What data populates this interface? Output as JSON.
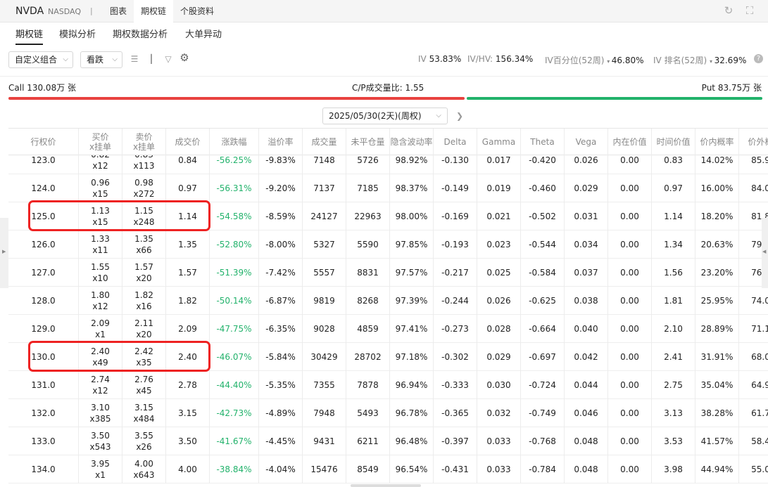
{
  "header": {
    "ticker": "NVDA",
    "exchange": "NASDAQ",
    "separator": "|",
    "tabs": [
      "图表",
      "期权链",
      "个股资料"
    ],
    "active_tab": "期权链"
  },
  "subnav": {
    "tabs": [
      "期权链",
      "模拟分析",
      "期权数据分析",
      "大单异动"
    ]
  },
  "filters": {
    "combo": "自定义组合",
    "direction": "看跌"
  },
  "stats": {
    "iv_label": "IV",
    "iv_value": "53.83%",
    "ivhv_label": "IV/HV:",
    "ivhv_value": "156.34%",
    "iv_pct_label": "IV百分位(52周)",
    "iv_pct_value": "46.80%",
    "iv_rank_label": "IV 排名(52周)",
    "iv_rank_value": "32.69%"
  },
  "cp": {
    "call_text": "Call 130.08万 张",
    "ratio_text": "C/P成交量比:  1.55",
    "put_text": "Put 83.75万 张",
    "call_share": 0.608
  },
  "expiry": {
    "label": "2025/05/30(2天)(周权)"
  },
  "columns": [
    [
      "行权价"
    ],
    [
      "买价",
      "x挂单"
    ],
    [
      "卖价",
      "x挂单"
    ],
    [
      "成交价"
    ],
    [
      "涨跌幅"
    ],
    [
      "溢价率"
    ],
    [
      "成交量"
    ],
    [
      "未平仓量"
    ],
    [
      "隐含波动率"
    ],
    [
      "Delta"
    ],
    [
      "Gamma"
    ],
    [
      "Theta"
    ],
    [
      "Vega"
    ],
    [
      "内在价值"
    ],
    [
      "时间价值"
    ],
    [
      "价内概率"
    ],
    [
      "价外概"
    ]
  ],
  "rows": [
    {
      "strike": "123.0",
      "bid": "0.82",
      "bid_size": "x12",
      "ask": "0.83",
      "ask_size": "x113",
      "last": "0.84",
      "chg": "-56.25%",
      "prem": "-9.83%",
      "vol": "7148",
      "oi": "5726",
      "iv": "98.92%",
      "delta": "-0.130",
      "gamma": "0.017",
      "theta": "-0.420",
      "vega": "0.026",
      "intrinsic": "0.00",
      "time": "0.83",
      "itm": "14.02%",
      "otm": "85.9"
    },
    {
      "strike": "124.0",
      "bid": "0.96",
      "bid_size": "x15",
      "ask": "0.98",
      "ask_size": "x272",
      "last": "0.97",
      "chg": "-56.31%",
      "prem": "-9.20%",
      "vol": "7137",
      "oi": "7185",
      "iv": "98.37%",
      "delta": "-0.149",
      "gamma": "0.019",
      "theta": "-0.460",
      "vega": "0.029",
      "intrinsic": "0.00",
      "time": "0.97",
      "itm": "16.00%",
      "otm": "84.0"
    },
    {
      "strike": "125.0",
      "bid": "1.13",
      "bid_size": "x15",
      "ask": "1.15",
      "ask_size": "x248",
      "last": "1.14",
      "chg": "-54.58%",
      "prem": "-8.59%",
      "vol": "24127",
      "oi": "22963",
      "iv": "98.00%",
      "delta": "-0.169",
      "gamma": "0.021",
      "theta": "-0.502",
      "vega": "0.031",
      "intrinsic": "0.00",
      "time": "1.14",
      "itm": "18.20%",
      "otm": "81.8"
    },
    {
      "strike": "126.0",
      "bid": "1.33",
      "bid_size": "x11",
      "ask": "1.35",
      "ask_size": "x66",
      "last": "1.35",
      "chg": "-52.80%",
      "prem": "-8.00%",
      "vol": "5327",
      "oi": "5590",
      "iv": "97.85%",
      "delta": "-0.193",
      "gamma": "0.023",
      "theta": "-0.544",
      "vega": "0.034",
      "intrinsic": "0.00",
      "time": "1.34",
      "itm": "20.63%",
      "otm": "79.3"
    },
    {
      "strike": "127.0",
      "bid": "1.55",
      "bid_size": "x10",
      "ask": "1.57",
      "ask_size": "x20",
      "last": "1.57",
      "chg": "-51.39%",
      "prem": "-7.42%",
      "vol": "5557",
      "oi": "8831",
      "iv": "97.57%",
      "delta": "-0.217",
      "gamma": "0.025",
      "theta": "-0.584",
      "vega": "0.037",
      "intrinsic": "0.00",
      "time": "1.56",
      "itm": "23.20%",
      "otm": "76.8"
    },
    {
      "strike": "128.0",
      "bid": "1.80",
      "bid_size": "x12",
      "ask": "1.82",
      "ask_size": "x16",
      "last": "1.82",
      "chg": "-50.14%",
      "prem": "-6.87%",
      "vol": "9819",
      "oi": "8268",
      "iv": "97.39%",
      "delta": "-0.244",
      "gamma": "0.026",
      "theta": "-0.625",
      "vega": "0.038",
      "intrinsic": "0.00",
      "time": "1.81",
      "itm": "25.95%",
      "otm": "74.0"
    },
    {
      "strike": "129.0",
      "bid": "2.09",
      "bid_size": "x1",
      "ask": "2.11",
      "ask_size": "x20",
      "last": "2.09",
      "chg": "-47.75%",
      "prem": "-6.35%",
      "vol": "9028",
      "oi": "4859",
      "iv": "97.41%",
      "delta": "-0.273",
      "gamma": "0.028",
      "theta": "-0.664",
      "vega": "0.040",
      "intrinsic": "0.00",
      "time": "2.10",
      "itm": "28.89%",
      "otm": "71.1"
    },
    {
      "strike": "130.0",
      "bid": "2.40",
      "bid_size": "x49",
      "ask": "2.42",
      "ask_size": "x35",
      "last": "2.40",
      "chg": "-46.07%",
      "prem": "-5.84%",
      "vol": "30429",
      "oi": "28702",
      "iv": "97.18%",
      "delta": "-0.302",
      "gamma": "0.029",
      "theta": "-0.697",
      "vega": "0.042",
      "intrinsic": "0.00",
      "time": "2.41",
      "itm": "31.91%",
      "otm": "68.0"
    },
    {
      "strike": "131.0",
      "bid": "2.74",
      "bid_size": "x12",
      "ask": "2.76",
      "ask_size": "x45",
      "last": "2.78",
      "chg": "-44.40%",
      "prem": "-5.35%",
      "vol": "7355",
      "oi": "7878",
      "iv": "96.94%",
      "delta": "-0.333",
      "gamma": "0.030",
      "theta": "-0.724",
      "vega": "0.044",
      "intrinsic": "0.00",
      "time": "2.75",
      "itm": "35.04%",
      "otm": "64.9"
    },
    {
      "strike": "132.0",
      "bid": "3.10",
      "bid_size": "x385",
      "ask": "3.15",
      "ask_size": "x484",
      "last": "3.15",
      "chg": "-42.73%",
      "prem": "-4.89%",
      "vol": "7948",
      "oi": "5493",
      "iv": "96.78%",
      "delta": "-0.365",
      "gamma": "0.032",
      "theta": "-0.749",
      "vega": "0.046",
      "intrinsic": "0.00",
      "time": "3.13",
      "itm": "38.28%",
      "otm": "61.7"
    },
    {
      "strike": "133.0",
      "bid": "3.50",
      "bid_size": "x543",
      "ask": "3.55",
      "ask_size": "x26",
      "last": "3.50",
      "chg": "-41.67%",
      "prem": "-4.45%",
      "vol": "9431",
      "oi": "6211",
      "iv": "96.48%",
      "delta": "-0.397",
      "gamma": "0.033",
      "theta": "-0.768",
      "vega": "0.048",
      "intrinsic": "0.00",
      "time": "3.53",
      "itm": "41.57%",
      "otm": "58.4"
    },
    {
      "strike": "134.0",
      "bid": "3.95",
      "bid_size": "x1",
      "ask": "4.00",
      "ask_size": "x643",
      "last": "4.00",
      "chg": "-38.84%",
      "prem": "-4.04%",
      "vol": "15476",
      "oi": "8549",
      "iv": "96.54%",
      "delta": "-0.431",
      "gamma": "0.033",
      "theta": "-0.784",
      "vega": "0.048",
      "intrinsic": "0.00",
      "time": "3.98",
      "itm": "44.94%",
      "otm": "55.0"
    }
  ],
  "highlighted_strikes": [
    "125.0",
    "130.0"
  ],
  "colors": {
    "up": "#22b26b",
    "down": "#e8423f",
    "highlight": "#ee2222"
  }
}
